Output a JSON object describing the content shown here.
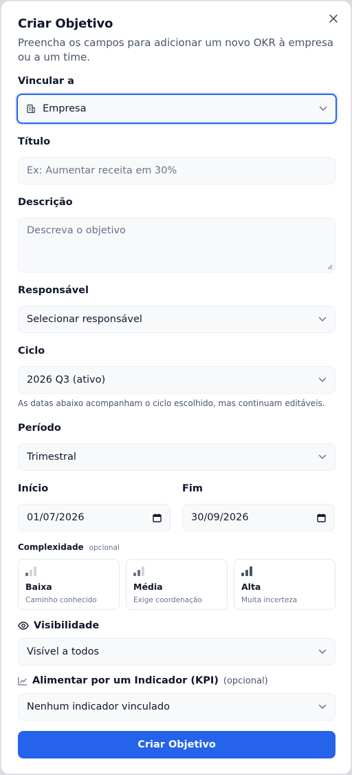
{
  "dialog": {
    "title": "Criar Objetivo",
    "subtitle": "Preencha os campos para adicionar um novo OKR à empresa ou a um time."
  },
  "link": {
    "label": "Vincular a",
    "value": "Empresa"
  },
  "title_field": {
    "label": "Título",
    "placeholder": "Ex: Aumentar receita em 30%"
  },
  "description": {
    "label": "Descrição",
    "placeholder": "Descreva o objetivo"
  },
  "owner": {
    "label": "Responsável",
    "value": "Selecionar responsável"
  },
  "cycle": {
    "label": "Ciclo",
    "value": "2026 Q3 (ativo)",
    "hint": "As datas abaixo acompanham o ciclo escolhido, mas continuam editáveis."
  },
  "period": {
    "label": "Período",
    "value": "Trimestral"
  },
  "start": {
    "label": "Início",
    "value": "01/07/2026"
  },
  "end": {
    "label": "Fim",
    "value": "30/09/2026"
  },
  "complexity": {
    "label": "Complexidade",
    "optional": "opcional",
    "options": [
      {
        "name": "Baixa",
        "desc": "Caminho conhecido"
      },
      {
        "name": "Média",
        "desc": "Exige coordenação"
      },
      {
        "name": "Alta",
        "desc": "Muita incerteza"
      }
    ]
  },
  "visibility": {
    "label": "Visibilidade",
    "value": "Visível a todos"
  },
  "kpi": {
    "label": "Alimentar por um Indicador (KPI)",
    "optional": "(opcional)",
    "value": "Nenhum indicador vinculado"
  },
  "submit_label": "Criar Objetivo",
  "colors": {
    "accent": "#2563eb",
    "focus_border": "#2563eb",
    "field_bg": "#f8f9fb"
  }
}
